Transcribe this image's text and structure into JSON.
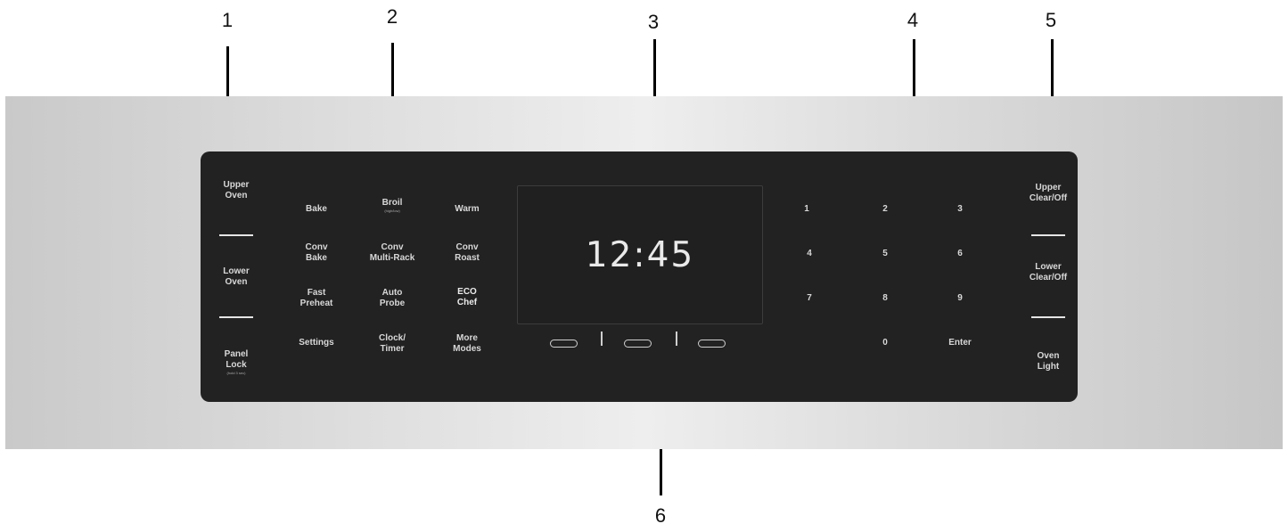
{
  "callouts": [
    "1",
    "2",
    "3",
    "4",
    "5",
    "6"
  ],
  "left_column": {
    "upper_oven": [
      "Upper",
      "Oven"
    ],
    "lower_oven": [
      "Lower",
      "Oven"
    ],
    "panel_lock": [
      "Panel",
      "Lock"
    ],
    "panel_lock_hint": "(hold 3 sec)"
  },
  "modes": {
    "bake": "Bake",
    "broil": "Broil",
    "broil_hint": "(high/low)",
    "warm": "Warm",
    "conv_bake": [
      "Conv",
      "Bake"
    ],
    "conv_multi_rack": [
      "Conv",
      "Multi-Rack"
    ],
    "conv_roast": [
      "Conv",
      "Roast"
    ],
    "fast_preheat": [
      "Fast",
      "Preheat"
    ],
    "auto_probe": [
      "Auto",
      "Probe"
    ],
    "eco_chef": [
      "ECO",
      "Chef"
    ],
    "settings": "Settings",
    "clock_timer": [
      "Clock/",
      "Timer"
    ],
    "more_modes": [
      "More",
      "Modes"
    ]
  },
  "display": {
    "time": "12:45"
  },
  "keypad": [
    "1",
    "2",
    "3",
    "4",
    "5",
    "6",
    "7",
    "8",
    "9",
    "0",
    "Enter"
  ],
  "right_column": {
    "upper_clear": [
      "Upper",
      "Clear/Off"
    ],
    "lower_clear": [
      "Lower",
      "Clear/Off"
    ],
    "oven_light": [
      "Oven",
      "Light"
    ]
  },
  "colors": {
    "panel": "#222222",
    "text": "#d8d8d8",
    "steel_light": "#eeeeee",
    "steel_dark": "#c6c6c6"
  }
}
